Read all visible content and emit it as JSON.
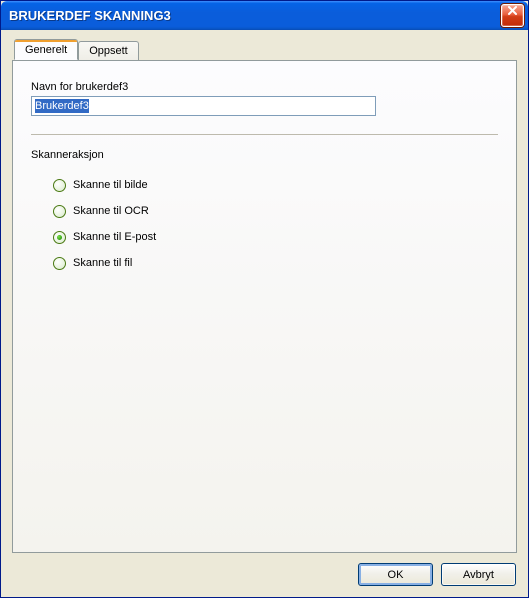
{
  "window": {
    "title": "BRUKERDEF SKANNING3"
  },
  "tabs": {
    "generelt": "Generelt",
    "oppsett": "Oppsett"
  },
  "name_field": {
    "label": "Navn for brukerdef3",
    "value": "Brukerdef3"
  },
  "scanner_action": {
    "label": "Skanneraksjon",
    "options": {
      "bilde": "Skanne til bilde",
      "ocr": "Skanne til OCR",
      "epost": "Skanne til E-post",
      "fil": "Skanne til fil"
    },
    "selected": "epost"
  },
  "buttons": {
    "ok": "OK",
    "cancel": "Avbryt"
  }
}
